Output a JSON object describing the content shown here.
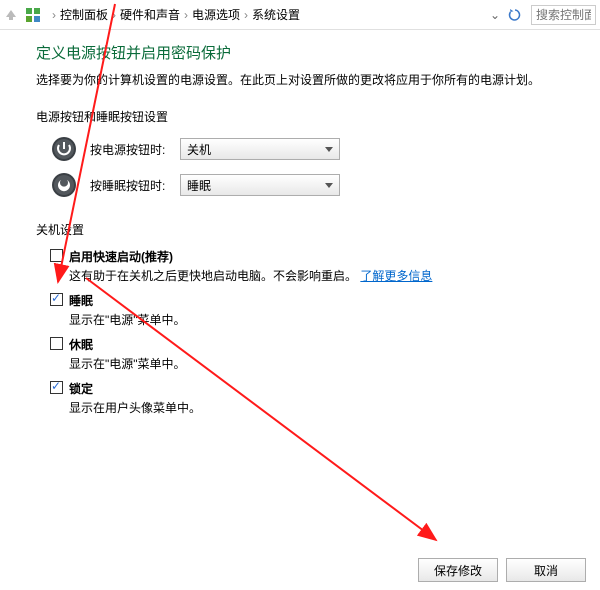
{
  "breadcrumb": {
    "items": [
      "控制面板",
      "硬件和声音",
      "电源选项",
      "系统设置"
    ]
  },
  "search": {
    "placeholder": "搜索控制面板"
  },
  "page_title": "定义电源按钮并启用密码保护",
  "subtitle": "选择要为你的计算机设置的电源设置。在此页上对设置所做的更改将应用于你所有的电源计划。",
  "button_section_title": "电源按钮和睡眠按钮设置",
  "power_button_label": "按电源按钮时:",
  "power_button_value": "关机",
  "sleep_button_label": "按睡眠按钮时:",
  "sleep_button_value": "睡眠",
  "shutdown_section_title": "关机设置",
  "options": {
    "fast": {
      "label": "启用快速启动(推荐)",
      "desc_prefix": "这有助于在关机之后更快地启动电脑。不会影响重启。",
      "link": "了解更多信息"
    },
    "sleep": {
      "label": "睡眠",
      "desc": "显示在\"电源\"菜单中。"
    },
    "hibernate": {
      "label": "休眠",
      "desc": "显示在\"电源\"菜单中。"
    },
    "lock": {
      "label": "锁定",
      "desc": "显示在用户头像菜单中。"
    }
  },
  "footer": {
    "save": "保存修改",
    "cancel": "取消"
  }
}
